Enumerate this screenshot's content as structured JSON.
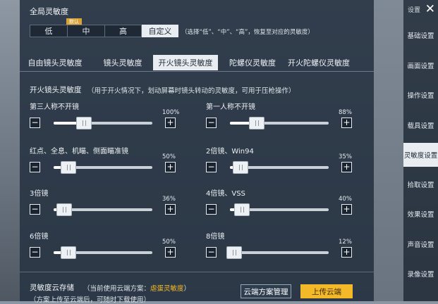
{
  "sidebar": {
    "title": "设置",
    "items": [
      {
        "label": "基础设置"
      },
      {
        "label": "画面设置"
      },
      {
        "label": "操作设置"
      },
      {
        "label": "载具设置"
      },
      {
        "label": "灵敏度设置"
      },
      {
        "label": "拾取设置"
      },
      {
        "label": "效果设置"
      },
      {
        "label": "声音设置"
      },
      {
        "label": "录像设置"
      }
    ],
    "active_index": 4
  },
  "global": {
    "title": "全局灵敏度",
    "badge": "默认",
    "options": [
      "低",
      "中",
      "高",
      "自定义"
    ],
    "selected": "自定义",
    "hint": "（选择“低”、“中”、“高”，恢复至对应的灵敏度）"
  },
  "tabs": {
    "items": [
      "自由镜头灵敏度",
      "镜头灵敏度",
      "开火镜头灵敏度",
      "陀螺仪灵敏度",
      "开火陀螺仪灵敏度"
    ],
    "selected": "开火镜头灵敏度"
  },
  "section": {
    "title": "开火镜头灵敏度",
    "desc": "（用于开火情况下，划动屏幕时镜头转动的灵敏度，可用于压枪操作）"
  },
  "sliders": [
    {
      "label": "第三人称不开镜",
      "value_text": "100%",
      "fraction": 0.31
    },
    {
      "label": "第一人称不开镜",
      "value_text": "88%",
      "fraction": 0.27
    },
    {
      "label": "红点、全息、机瞄、侧面瞄准镜",
      "value_text": "50%",
      "fraction": 0.15
    },
    {
      "label": "2倍镜、Win94",
      "value_text": "35%",
      "fraction": 0.11
    },
    {
      "label": "3倍镜",
      "value_text": "36%",
      "fraction": 0.11
    },
    {
      "label": "4倍镜、VSS",
      "value_text": "40%",
      "fraction": 0.12
    },
    {
      "label": "6倍镜",
      "value_text": "50%",
      "fraction": 0.15
    },
    {
      "label": "8倍镜",
      "value_text": "12%",
      "fraction": 0.04
    }
  ],
  "buttons": {
    "minus": "−",
    "plus": "+"
  },
  "cloud": {
    "title": "灵敏度云存储",
    "current_prefix": "（当前使用云端方案：",
    "current_name": "虐蛋灵敏度",
    "current_suffix": "）",
    "note": "（方案上传至云端后，可随时下载使用）",
    "manage_label": "云端方案管理",
    "upload_label": "上传云端"
  },
  "colors": {
    "accent": "#f4b928",
    "selected_bg": "#e9edf1",
    "panel_bg": "#283442"
  }
}
